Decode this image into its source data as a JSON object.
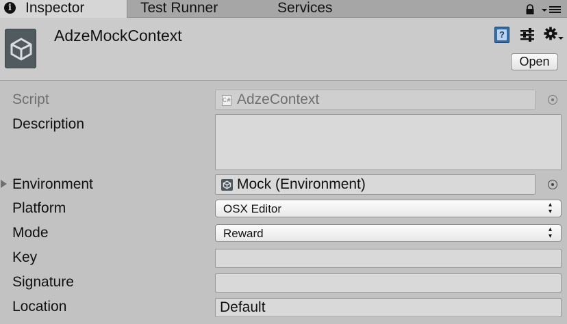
{
  "tabs": {
    "inspector": "Inspector",
    "test_runner": "Test Runner",
    "services": "Services",
    "icons": {
      "inspector": "info-icon",
      "lock": "lock-icon",
      "menu": "menu-icon"
    }
  },
  "header": {
    "title": "AdzeMockContext",
    "open_label": "Open",
    "icons": {
      "asset": "unity-logo-icon",
      "help": "help-book-icon",
      "presets": "presets-icon",
      "settings": "gear-icon"
    }
  },
  "properties": {
    "script": {
      "label": "Script",
      "value": "AdzeContext",
      "icon": "csharp-script-icon"
    },
    "description": {
      "label": "Description",
      "value": ""
    },
    "environment": {
      "label": "Environment",
      "value": "Mock (Environment)",
      "icon": "unity-asset-icon"
    },
    "platform": {
      "label": "Platform",
      "value": "OSX Editor"
    },
    "mode": {
      "label": "Mode",
      "value": "Reward"
    },
    "key": {
      "label": "Key",
      "value": ""
    },
    "signature": {
      "label": "Signature",
      "value": ""
    },
    "location": {
      "label": "Location",
      "value": "Default"
    }
  },
  "colors": {
    "panel_bg": "#c2c2c2",
    "header_bg": "#cbcbcb",
    "tabbar_bg": "#a6a6a6",
    "active_tab_bg": "#d6d6d6",
    "field_bg": "#d9d9d9"
  }
}
